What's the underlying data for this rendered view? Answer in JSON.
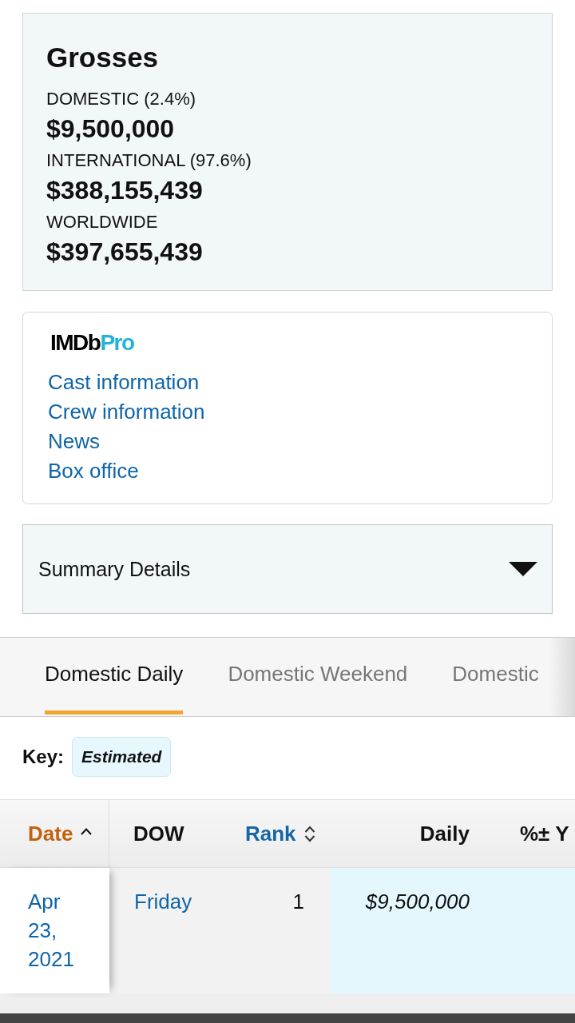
{
  "grosses": {
    "title": "Grosses",
    "items": [
      {
        "label": "DOMESTIC (2.4%)",
        "amount": "$9,500,000"
      },
      {
        "label": "INTERNATIONAL (97.6%)",
        "amount": "$388,155,439"
      },
      {
        "label": "WORLDWIDE",
        "amount": "$397,655,439"
      }
    ]
  },
  "imdbpro": {
    "logo": {
      "primary": "IMDb",
      "accent": "Pro"
    },
    "links": [
      "Cast information",
      "Crew information",
      "News",
      "Box office"
    ]
  },
  "summary": {
    "label": "Summary Details",
    "expanded": false
  },
  "tabs": [
    {
      "label": "Domestic Daily",
      "selected": true
    },
    {
      "label": "Domestic Weekend",
      "selected": false
    },
    {
      "label": "Domestic",
      "selected": false
    }
  ],
  "key": {
    "label": "Key:",
    "badge": "Estimated"
  },
  "table": {
    "columns": [
      {
        "label": "Date",
        "sortable": true,
        "sorted": true
      },
      {
        "label": "DOW",
        "sortable": false,
        "sorted": false
      },
      {
        "label": "Rank",
        "sortable": true,
        "sorted": false
      },
      {
        "label": "Daily",
        "sortable": false,
        "sorted": false
      },
      {
        "label": "%± Y",
        "sortable": false,
        "sorted": false
      }
    ],
    "rows": [
      {
        "date": "Apr 23, 2021",
        "dow": "Friday",
        "rank": "1",
        "daily": "$9,500,000",
        "estimated": true
      }
    ]
  }
}
